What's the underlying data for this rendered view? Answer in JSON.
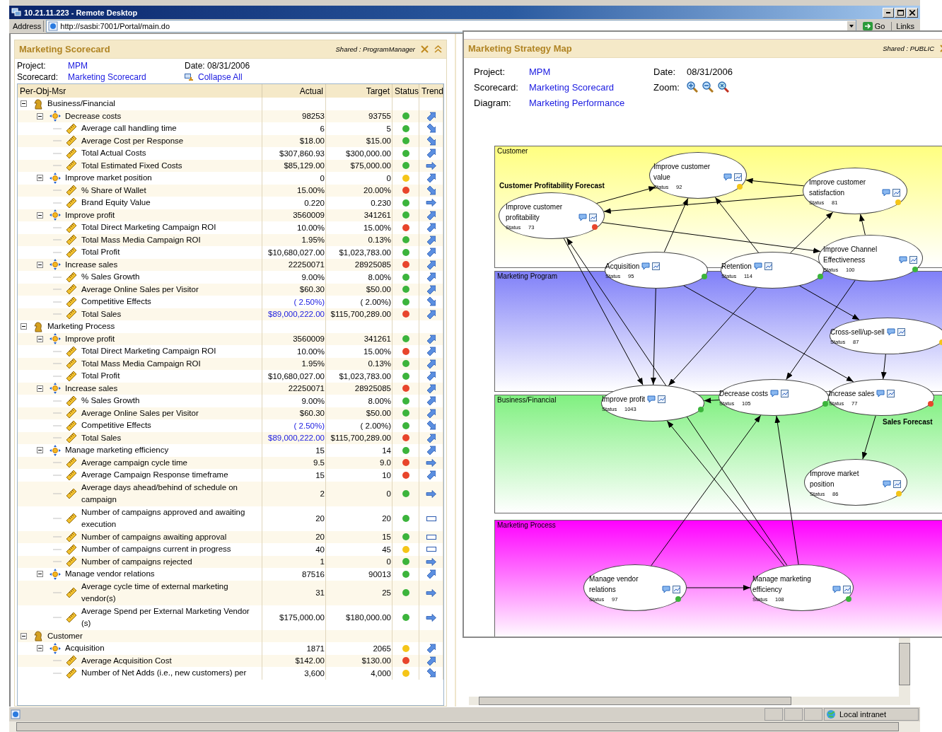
{
  "remote_desktop": {
    "title": "10.21.11.223 - Remote Desktop"
  },
  "address_bar": {
    "label": "Address",
    "url": "http://sasbi:7001/Portal/main.do",
    "go": "Go",
    "links": "Links"
  },
  "scorecard": {
    "title": "Marketing Scorecard",
    "shared": "Shared : ProgramManager",
    "project_label": "Project:",
    "project": "MPM",
    "scorecard_label": "Scorecard:",
    "scorecard": "Marketing Scorecard",
    "date_label": "Date:",
    "date": "08/31/2006",
    "collapse": "Collapse All",
    "columns": [
      "Per-Obj-Msr",
      "Actual",
      "Target",
      "Status",
      "Trend"
    ],
    "rows": [
      {
        "kind": "perspective",
        "name": "Business/Financial",
        "expanded": true,
        "children": [
          {
            "kind": "objective",
            "name": "Decrease costs",
            "actual": "98253",
            "target": "93755",
            "color": "#3cb43c",
            "trend": {
              "kind": "up"
            },
            "expanded": true,
            "children": [
              {
                "kind": "measure",
                "name": "Average call handling time",
                "actual": "6",
                "target": "5",
                "color": "#3cb43c",
                "trend": {
                  "kind": "down"
                },
                "actual_link": false
              },
              {
                "kind": "measure",
                "name": "Average Cost per Response",
                "actual": "$18.00",
                "target": "$15.00",
                "color": "#3cb43c",
                "trend": {
                  "kind": "down"
                },
                "actual_link": false
              },
              {
                "kind": "measure",
                "name": "Total Actual Costs",
                "actual": "$307,860.93",
                "target": "$300,000.00",
                "color": "#3cb43c",
                "trend": {
                  "kind": "up"
                },
                "actual_link": false
              },
              {
                "kind": "measure",
                "name": "Total Estimated Fixed Costs",
                "actual": "$85,129.00",
                "target": "$75,000.00",
                "color": "#3cb43c",
                "trend": {
                  "kind": "right"
                },
                "actual_link": false
              }
            ]
          },
          {
            "kind": "objective",
            "name": "Improve market position",
            "actual": "0",
            "target": "0",
            "color": "#f5c518",
            "trend": {
              "kind": "up"
            },
            "expanded": true,
            "children": [
              {
                "kind": "measure",
                "name": "% Share of Wallet",
                "actual": "15.00%",
                "target": "20.00%",
                "color": "#e8452c",
                "trend": {
                  "kind": "down"
                },
                "actual_link": false
              },
              {
                "kind": "measure",
                "name": "Brand Equity Value",
                "actual": "0.220",
                "target": "0.230",
                "color": "#3cb43c",
                "trend": {
                  "kind": "right"
                },
                "actual_link": false
              }
            ]
          },
          {
            "kind": "objective",
            "name": "Improve profit",
            "actual": "3560009",
            "target": "341261",
            "color": "#3cb43c",
            "trend": {
              "kind": "up"
            },
            "expanded": true,
            "children": [
              {
                "kind": "measure",
                "name": "Total Direct Marketing Campaign ROI",
                "actual": "10.00%",
                "target": "15.00%",
                "color": "#e8452c",
                "trend": {
                  "kind": "up"
                },
                "actual_link": false
              },
              {
                "kind": "measure",
                "name": "Total Mass Media Campaign ROI",
                "actual": "1.95%",
                "target": "0.13%",
                "color": "#3cb43c",
                "trend": {
                  "kind": "up"
                },
                "actual_link": false
              },
              {
                "kind": "measure",
                "name": "Total Profit",
                "actual": "$10,680,027.00",
                "target": "$1,023,783.00",
                "color": "#3cb43c",
                "trend": {
                  "kind": "up"
                },
                "actual_link": false
              }
            ]
          },
          {
            "kind": "objective",
            "name": "Increase sales",
            "actual": "22250071",
            "target": "28925085",
            "color": "#e8452c",
            "trend": {
              "kind": "up"
            },
            "expanded": true,
            "children": [
              {
                "kind": "measure",
                "name": "% Sales Growth",
                "actual": "9.00%",
                "target": "8.00%",
                "color": "#3cb43c",
                "trend": {
                  "kind": "up"
                },
                "actual_link": false
              },
              {
                "kind": "measure",
                "name": "Average Online Sales per Visitor",
                "actual": "$60.30",
                "target": "$50.00",
                "color": "#3cb43c",
                "trend": {
                  "kind": "up"
                },
                "actual_link": false
              },
              {
                "kind": "measure",
                "name": "Competitive Effects",
                "actual": "( 2.50%)",
                "target": "( 2.00%)",
                "color": "#3cb43c",
                "trend": {
                  "kind": "down"
                },
                "actual_link": true
              },
              {
                "kind": "measure",
                "name": "Total Sales",
                "actual": "$89,000,222.00",
                "target": "$115,700,289.00",
                "color": "#e8452c",
                "trend": {
                  "kind": "up"
                },
                "actual_link": true
              }
            ]
          }
        ]
      },
      {
        "kind": "perspective",
        "name": "Marketing Process",
        "expanded": true,
        "children": [
          {
            "kind": "objective",
            "name": "Improve profit",
            "actual": "3560009",
            "target": "341261",
            "color": "#3cb43c",
            "trend": {
              "kind": "up"
            },
            "expanded": true,
            "children": [
              {
                "kind": "measure",
                "name": "Total Direct Marketing Campaign ROI",
                "actual": "10.00%",
                "target": "15.00%",
                "color": "#e8452c",
                "trend": {
                  "kind": "up"
                },
                "actual_link": false
              },
              {
                "kind": "measure",
                "name": "Total Mass Media Campaign ROI",
                "actual": "1.95%",
                "target": "0.13%",
                "color": "#3cb43c",
                "trend": {
                  "kind": "up"
                },
                "actual_link": false
              },
              {
                "kind": "measure",
                "name": "Total Profit",
                "actual": "$10,680,027.00",
                "target": "$1,023,783.00",
                "color": "#3cb43c",
                "trend": {
                  "kind": "up"
                },
                "actual_link": false
              }
            ]
          },
          {
            "kind": "objective",
            "name": "Increase sales",
            "actual": "22250071",
            "target": "28925085",
            "color": "#e8452c",
            "trend": {
              "kind": "up"
            },
            "expanded": true,
            "children": [
              {
                "kind": "measure",
                "name": "% Sales Growth",
                "actual": "9.00%",
                "target": "8.00%",
                "color": "#3cb43c",
                "trend": {
                  "kind": "up"
                },
                "actual_link": false
              },
              {
                "kind": "measure",
                "name": "Average Online Sales per Visitor",
                "actual": "$60.30",
                "target": "$50.00",
                "color": "#3cb43c",
                "trend": {
                  "kind": "up"
                },
                "actual_link": false
              },
              {
                "kind": "measure",
                "name": "Competitive Effects",
                "actual": "( 2.50%)",
                "target": "( 2.00%)",
                "color": "#3cb43c",
                "trend": {
                  "kind": "down"
                },
                "actual_link": true
              },
              {
                "kind": "measure",
                "name": "Total Sales",
                "actual": "$89,000,222.00",
                "target": "$115,700,289.00",
                "color": "#e8452c",
                "trend": {
                  "kind": "up"
                },
                "actual_link": true
              }
            ]
          },
          {
            "kind": "objective",
            "name": "Manage marketing efficiency",
            "actual": "15",
            "target": "14",
            "color": "#3cb43c",
            "trend": {
              "kind": "up"
            },
            "expanded": true,
            "children": [
              {
                "kind": "measure",
                "name": "Average campaign cycle time",
                "actual": "9.5",
                "target": "9.0",
                "color": "#e8452c",
                "trend": {
                  "kind": "right"
                },
                "actual_link": false
              },
              {
                "kind": "measure",
                "name": "Average Campaign Response timeframe",
                "actual": "15",
                "target": "10",
                "color": "#e8452c",
                "trend": {
                  "kind": "up"
                },
                "actual_link": false
              },
              {
                "kind": "measure",
                "name": "Average days ahead/behind of schedule on campaign",
                "actual": "2",
                "target": "0",
                "color": "#3cb43c",
                "trend": {
                  "kind": "right"
                },
                "actual_link": false
              },
              {
                "kind": "measure",
                "name": "Number of campaigns approved and awaiting execution",
                "actual": "20",
                "target": "20",
                "color": "#3cb43c",
                "trend": {
                  "kind": "flat"
                },
                "actual_link": false
              },
              {
                "kind": "measure",
                "name": "Number of campaigns awaiting approval",
                "actual": "20",
                "target": "15",
                "color": "#3cb43c",
                "trend": {
                  "kind": "flat"
                },
                "actual_link": false
              },
              {
                "kind": "measure",
                "name": "Number of campaigns current in progress",
                "actual": "40",
                "target": "45",
                "color": "#f5c518",
                "trend": {
                  "kind": "flat"
                },
                "actual_link": false
              },
              {
                "kind": "measure",
                "name": "Number of campaigns rejected",
                "actual": "1",
                "target": "0",
                "color": "#3cb43c",
                "trend": {
                  "kind": "right"
                },
                "actual_link": false
              }
            ]
          },
          {
            "kind": "objective",
            "name": "Manage vendor relations",
            "actual": "87516",
            "target": "90013",
            "color": "#3cb43c",
            "trend": {
              "kind": "up"
            },
            "expanded": true,
            "children": [
              {
                "kind": "measure",
                "name": "Average cycle time of external marketing vendor(s)",
                "actual": "31",
                "target": "25",
                "color": "#3cb43c",
                "trend": {
                  "kind": "right"
                },
                "actual_link": false
              },
              {
                "kind": "measure",
                "name": "Average Spend per External Marketing Vendor (s)",
                "actual": "$175,000.00",
                "target": "$180,000.00",
                "color": "#3cb43c",
                "trend": {
                  "kind": "right"
                },
                "actual_link": false
              }
            ]
          }
        ]
      },
      {
        "kind": "perspective",
        "name": "Customer",
        "expanded": true,
        "children": [
          {
            "kind": "objective",
            "name": "Acquisition",
            "actual": "1871",
            "target": "2065",
            "color": "#f5c518",
            "trend": {
              "kind": "up"
            },
            "expanded": true,
            "children": [
              {
                "kind": "measure",
                "name": "Average Acquisition Cost",
                "actual": "$142.00",
                "target": "$130.00",
                "color": "#e8452c",
                "trend": {
                  "kind": "up"
                },
                "actual_link": false
              },
              {
                "kind": "measure",
                "name": "Number of Net Adds (i.e., new customers) per",
                "actual": "3,600",
                "target": "4,000",
                "color": "#f5c518",
                "trend": {
                  "kind": "down"
                },
                "actual_link": false
              }
            ]
          }
        ]
      }
    ]
  },
  "strategy_map": {
    "title": "Marketing Strategy Map",
    "shared": "Shared : PUBLIC",
    "project_label": "Project:",
    "project": "MPM",
    "scorecard_label": "Scorecard:",
    "scorecard": "Marketing Scorecard",
    "diagram_label": "Diagram:",
    "diagram": "Marketing Performance",
    "date_label": "Date:",
    "date": "08/31/2006",
    "zoom_label": "Zoom:",
    "bands": [
      {
        "name": "Customer",
        "color": "#ffff80",
        "forecast": "Customer Profitability Forecast"
      },
      {
        "name": "Marketing Program",
        "color": "#8080f8"
      },
      {
        "name": "Business/Financial",
        "color": "#80f080",
        "forecast": "Sales Forecast"
      },
      {
        "name": "Marketing Process",
        "color": "#ff00ff"
      }
    ],
    "nodes": [
      {
        "title": "Improve customer value",
        "status_label": "Status",
        "status": "92",
        "color": "#f5c518"
      },
      {
        "title": "Improve customer satisfaction",
        "status_label": "Status",
        "status": "81",
        "color": "#f5c518"
      },
      {
        "title": "Improve customer profitability",
        "status_label": "Status",
        "status": "73",
        "color": "#e8452c"
      },
      {
        "title": "Improve Channel Effectiveness",
        "status_label": "Status",
        "status": "100",
        "color": "#3cb43c"
      },
      {
        "title": "Acquisition",
        "status_label": "Status",
        "status": "95",
        "color": "#3cb43c"
      },
      {
        "title": "Retention",
        "status_label": "Status",
        "status": "114",
        "color": "#3cb43c"
      },
      {
        "title": "Cross-sell/up-sell",
        "status_label": "Status",
        "status": "87",
        "color": "#f5c518"
      },
      {
        "title": "Improve profit",
        "status_label": "Status",
        "status": "1043",
        "color": "#3cb43c"
      },
      {
        "title": "Decrease costs",
        "status_label": "Status",
        "status": "105",
        "color": "#3cb43c"
      },
      {
        "title": "Increase sales",
        "status_label": "Status",
        "status": "77",
        "color": "#e8452c"
      },
      {
        "title": "Improve market position",
        "status_label": "Status",
        "status": "86",
        "color": "#f5c518"
      },
      {
        "title": "Manage vendor relations",
        "status_label": "Status",
        "status": "97",
        "color": "#3cb43c"
      },
      {
        "title": "Manage marketing efficiency",
        "status_label": "Status",
        "status": "108",
        "color": "#3cb43c"
      }
    ]
  },
  "status_bar": {
    "zone": "Local intranet"
  }
}
